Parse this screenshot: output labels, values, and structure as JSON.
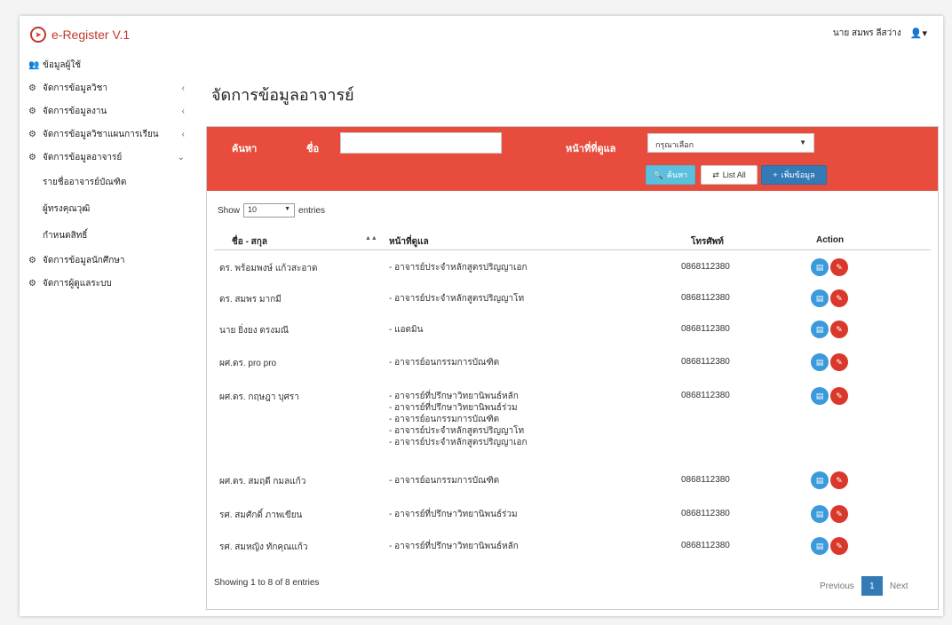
{
  "app": {
    "brand": "e-Register V.1",
    "brand_icon": "send-icon"
  },
  "user": {
    "name": "นาย สมพร ลีสว่าง",
    "icon": "user-icon"
  },
  "sidebar": {
    "items": [
      {
        "label": "ข้อมูลผู้ใช้",
        "icon": "users-icon"
      },
      {
        "label": "จัดการข้อมูลวิชา",
        "icon": "gears-icon",
        "chevron": "‹"
      },
      {
        "label": "จัดการข้อมูลงาน",
        "icon": "gears-icon",
        "chevron": "‹"
      },
      {
        "label": "จัดการข้อมูลวิชาแผนการเรียน",
        "icon": "gears-icon",
        "chevron": "‹"
      },
      {
        "label": "จัดการข้อมูลอาจารย์",
        "icon": "gears-icon",
        "chevron": "⌄"
      }
    ],
    "subitems": [
      {
        "label": "รายชื่ออาจารย์บัณฑิต"
      },
      {
        "label": "ผู้ทรงคุณวุฒิ"
      },
      {
        "label": "กำหนดสิทธิ์"
      }
    ],
    "items_after": [
      {
        "label": "จัดการข้อมูลนักศึกษา",
        "icon": "gears-icon"
      },
      {
        "label": "จัดการผู้ดูแลระบบ",
        "icon": "gears-icon"
      }
    ]
  },
  "main": {
    "title": "จัดการข้อมูลอาจารย์"
  },
  "filter": {
    "search_label": "ค้นหา",
    "name_label": "ชื่อ",
    "name_value": "",
    "responsibility_label": "หน้าที่ที่ดูแล",
    "responsibility_selected": "กรุณาเลือก",
    "search_button": "ค้นหา",
    "list_all_button": "List All",
    "add_button": "เพิ่มข้อมูล",
    "header_color": "#e74c3c"
  },
  "table": {
    "show_label": "Show",
    "show_value": "10",
    "entries_label": "entries",
    "columns": [
      "ชื่อ - สกุล",
      "หน้าที่ดูแล",
      "โทรศัพท์",
      "Action"
    ],
    "rows": [
      {
        "name": "ดร. พร้อมพงษ์ แก้วสะอาด",
        "duties": [
          "- อาจารย์ประจำหลักสูตรปริญญาเอก"
        ],
        "phone": "0868112380"
      },
      {
        "name": "ดร. สมพร มากมี",
        "duties": [
          "- อาจารย์ประจำหลักสูตรปริญญาโท"
        ],
        "phone": "0868112380"
      },
      {
        "name": "นาย ยิ่งยง ตรงมณี",
        "duties": [
          "- แอดมิน"
        ],
        "phone": "0868112380"
      },
      {
        "name": "ผศ.ดร. pro pro",
        "duties": [
          "- อาจารย์อนกรรมการบัณฑิต"
        ],
        "phone": "0868112380"
      },
      {
        "name": "ผศ.ดร. กฤษฎา บุศรา",
        "duties": [
          "- อาจารย์ที่ปรึกษาวิทยานิพนธ์หลัก",
          "- อาจารย์ที่ปรึกษาวิทยานิพนธ์ร่วม",
          "- อาจารย์อนกรรมการบัณฑิต",
          "- อาจารย์ประจำหลักสูตรปริญญาโท",
          "- อาจารย์ประจำหลักสูตรปริญญาเอก"
        ],
        "phone": "0868112380"
      },
      {
        "name": "ผศ.ดร. สมฤดี กมลแก้ว",
        "duties": [
          "- อาจารย์อนกรรมการบัณฑิต"
        ],
        "phone": "0868112380"
      },
      {
        "name": "รศ. สมศักดิ์ ภาพเขียน",
        "duties": [
          "- อาจารย์ที่ปรึกษาวิทยานิพนธ์ร่วม"
        ],
        "phone": "0868112380"
      },
      {
        "name": "รศ. สมหญิง ทักคุณแก้ว",
        "duties": [
          "- อาจารย์ที่ปรึกษาวิทยานิพนธ์หลัก"
        ],
        "phone": "0868112380"
      }
    ],
    "footer": "Showing 1 to 8 of 8 entries",
    "pager": {
      "previous": "Previous",
      "current": "1",
      "next": "Next"
    }
  }
}
